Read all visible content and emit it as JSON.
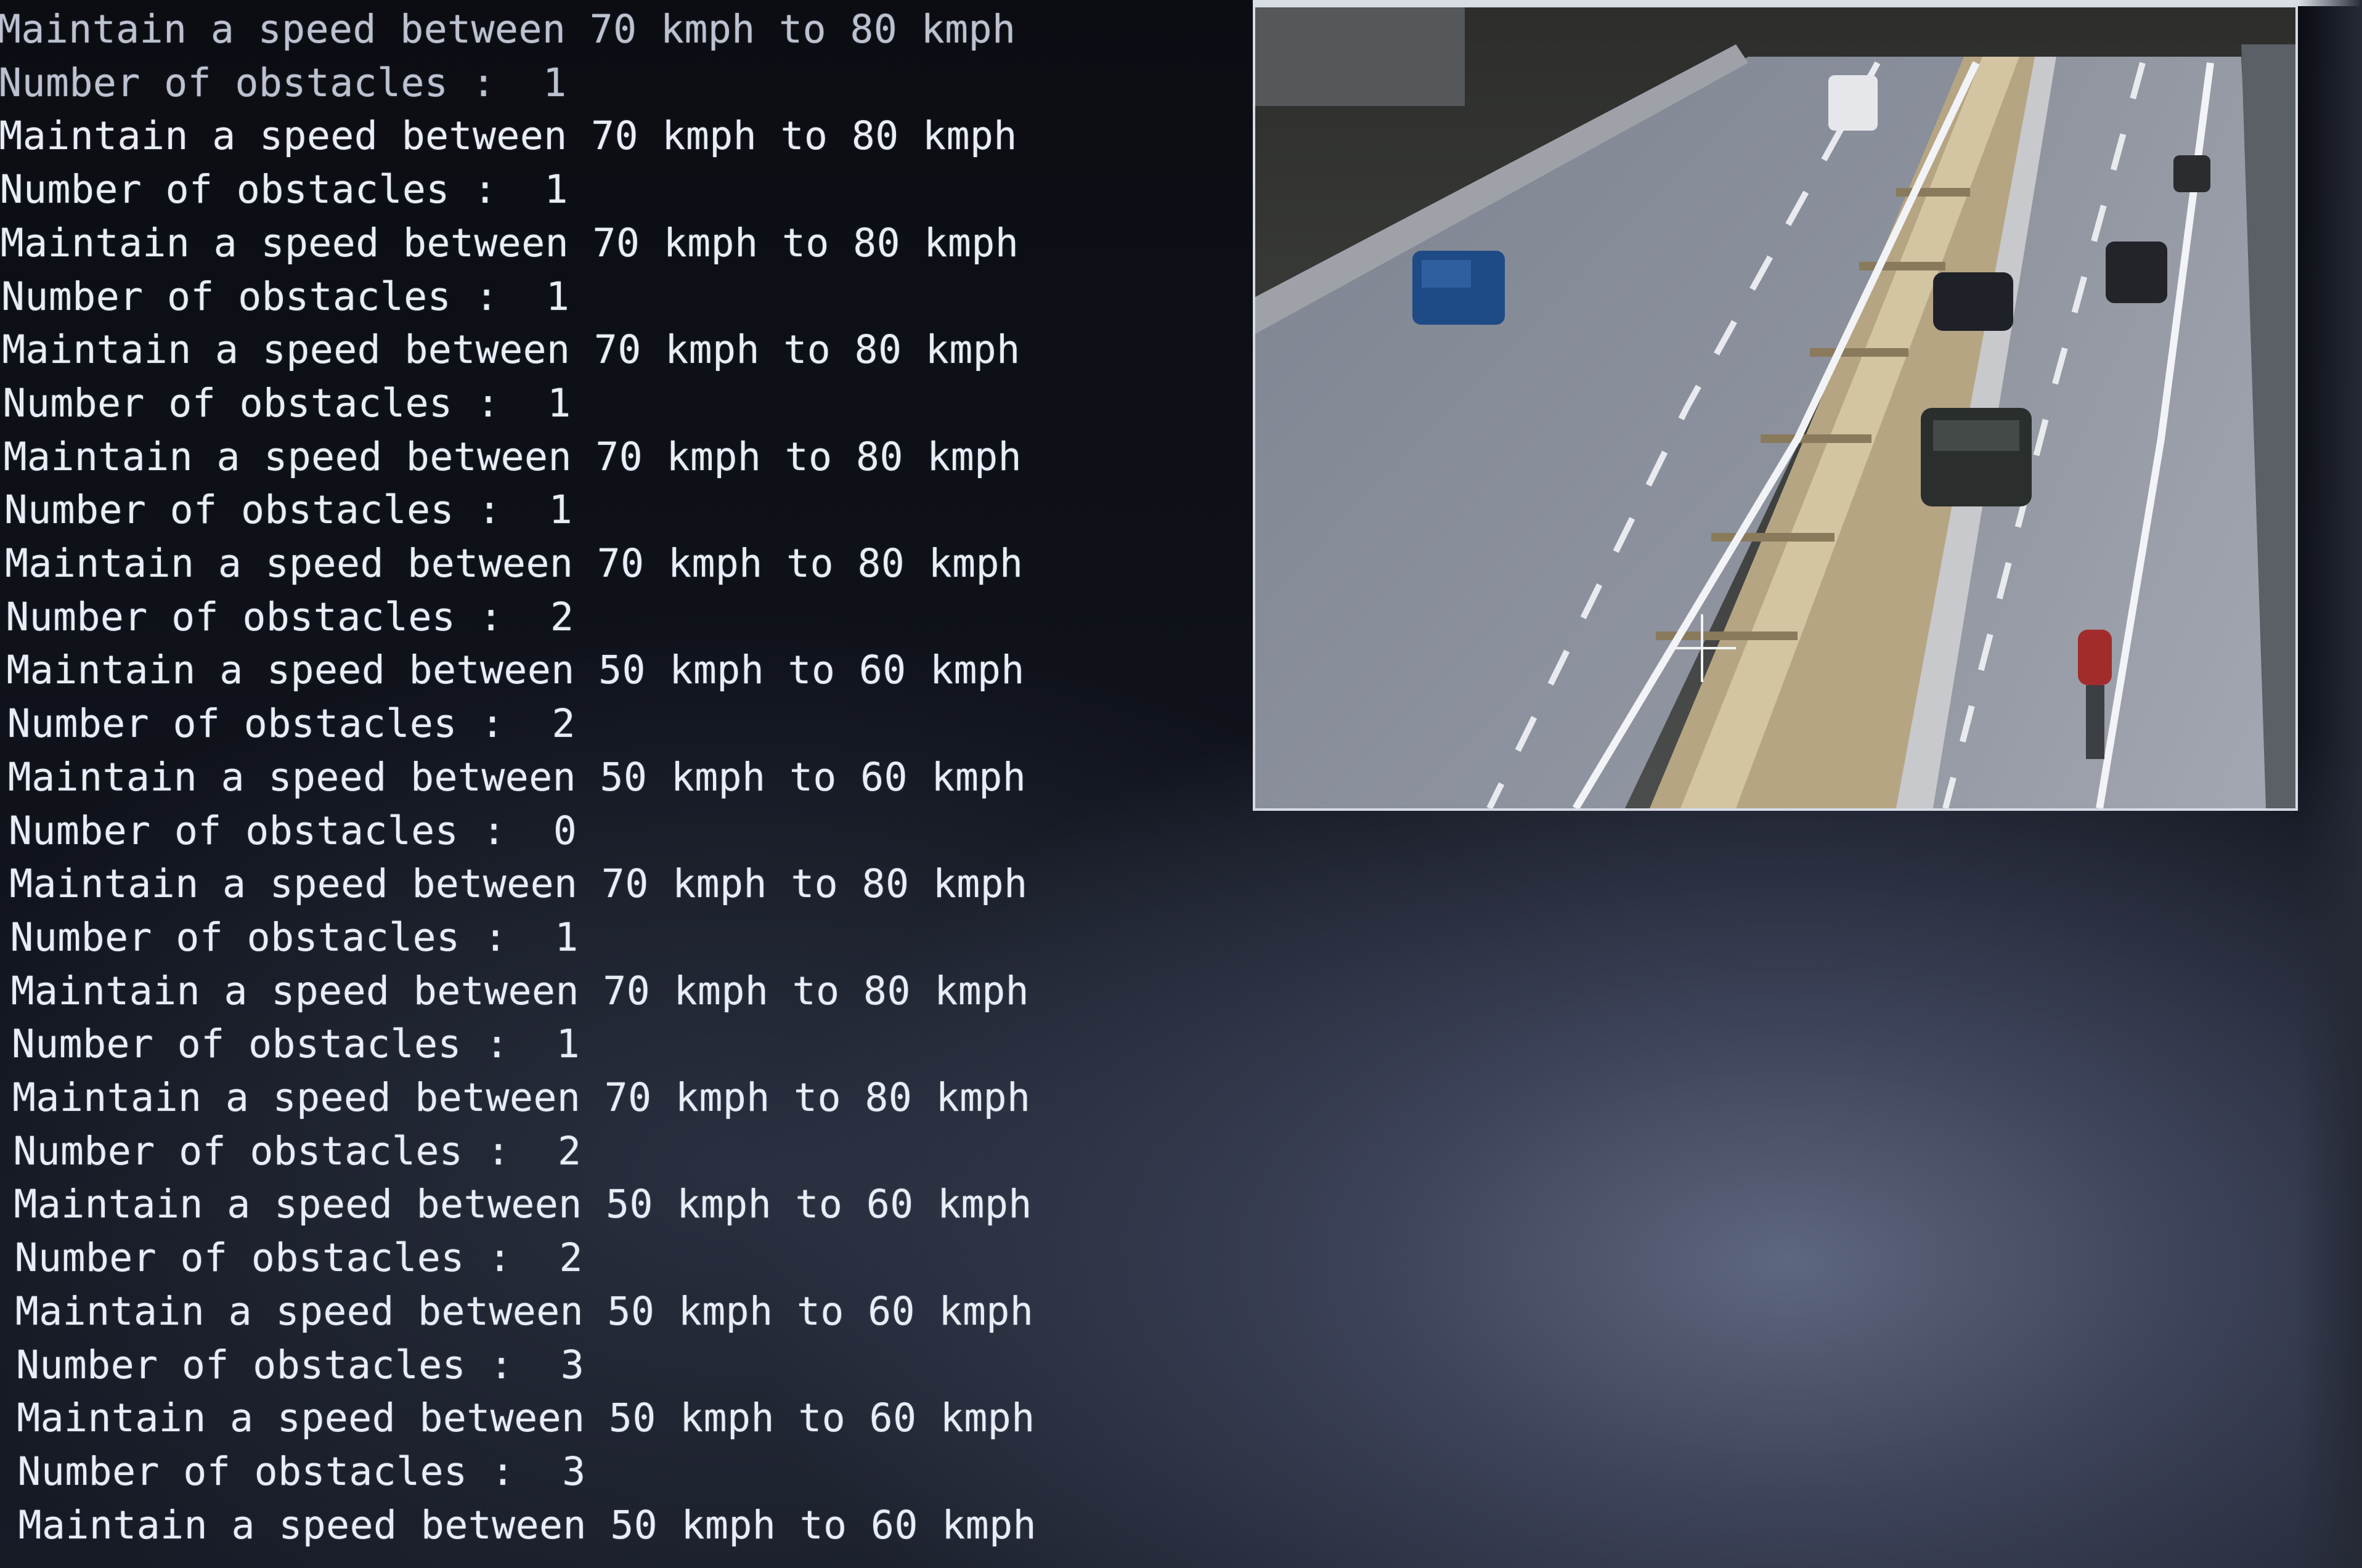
{
  "console": {
    "lines": [
      "Maintain a speed between 70 kmph to 80 kmph",
      "Number of obstacles :  1",
      "Maintain a speed between 70 kmph to 80 kmph",
      "Number of obstacles :  1",
      "Maintain a speed between 70 kmph to 80 kmph",
      "Number of obstacles :  1",
      "Maintain a speed between 70 kmph to 80 kmph",
      "Number of obstacles :  1",
      "Maintain a speed between 70 kmph to 80 kmph",
      "Number of obstacles :  1",
      "Maintain a speed between 70 kmph to 80 kmph",
      "Number of obstacles :  2",
      "Maintain a speed between 50 kmph to 60 kmph",
      "Number of obstacles :  2",
      "Maintain a speed between 50 kmph to 60 kmph",
      "Number of obstacles :  0",
      "Maintain a speed between 70 kmph to 80 kmph",
      "Number of obstacles :  1",
      "Maintain a speed between 70 kmph to 80 kmph",
      "Number of obstacles :  1",
      "Maintain a speed between 70 kmph to 80 kmph",
      "Number of obstacles :  2",
      "Maintain a speed between 50 kmph to 60 kmph",
      "Number of obstacles :  2",
      "Maintain a speed between 50 kmph to 60 kmph",
      "Number of obstacles :  3",
      "Maintain a speed between 50 kmph to 60 kmph",
      "Number of obstacles :  3",
      "Maintain a speed between 50 kmph to 60 kmph"
    ]
  },
  "video": {
    "osd_text": "",
    "scene_colors": {
      "road": "#8c8f96",
      "median": "#c9b896",
      "sky": "#3a3d3c"
    }
  }
}
